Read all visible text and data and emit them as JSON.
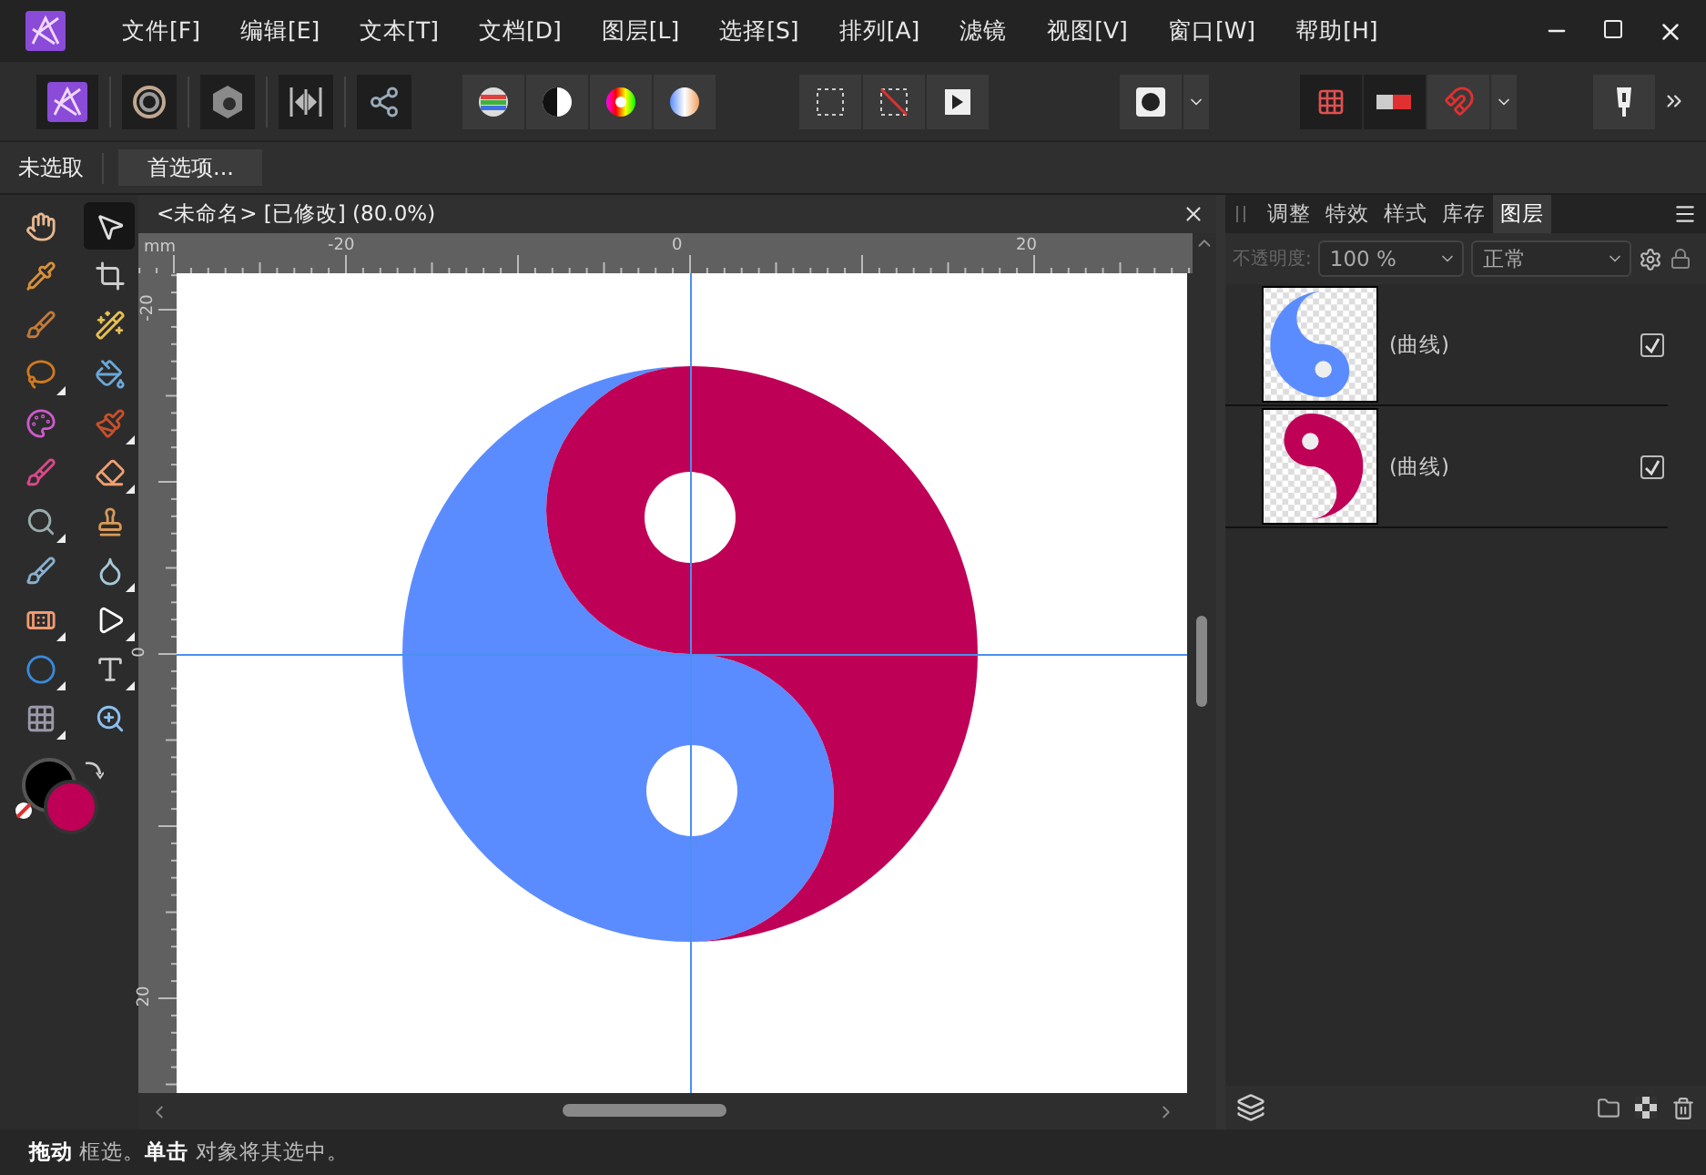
{
  "menu": [
    "文件[F]",
    "编辑[E]",
    "文本[T]",
    "文档[D]",
    "图层[L]",
    "选择[S]",
    "排列[A]",
    "滤镜",
    "视图[V]",
    "窗口[W]",
    "帮助[H]"
  ],
  "context_bar": {
    "status": "未选取",
    "button": "首选项..."
  },
  "tools": [
    {
      "selected": false,
      "flyout": false
    },
    {
      "selected": true,
      "flyout": false
    },
    {
      "selected": false,
      "flyout": false
    },
    {
      "selected": false,
      "flyout": false
    },
    {
      "selected": false,
      "flyout": false
    },
    {
      "selected": false,
      "flyout": false
    },
    {
      "selected": false,
      "flyout": true
    },
    {
      "selected": false,
      "flyout": false
    },
    {
      "selected": false,
      "flyout": false
    },
    {
      "selected": false,
      "flyout": true
    },
    {
      "selected": false,
      "flyout": false
    },
    {
      "selected": false,
      "flyout": true
    },
    {
      "selected": false,
      "flyout": true
    },
    {
      "selected": false,
      "flyout": false
    },
    {
      "selected": false,
      "flyout": false
    },
    {
      "selected": false,
      "flyout": true
    },
    {
      "selected": false,
      "flyout": true
    },
    {
      "selected": false,
      "flyout": true
    },
    {
      "selected": false,
      "flyout": true
    },
    {
      "selected": false,
      "flyout": true
    },
    {
      "selected": false,
      "flyout": true
    },
    {
      "selected": false,
      "flyout": false
    }
  ],
  "document": {
    "title": "<未命名> [已修改] (80.0%)",
    "ruler": {
      "unit": "mm",
      "horizontal": [
        "-20",
        "0",
        "20"
      ],
      "vertical": [
        "-20",
        "0",
        "20"
      ]
    }
  },
  "panel": {
    "tabs": [
      {
        "label": "调整",
        "selected": false
      },
      {
        "label": "特效",
        "selected": false
      },
      {
        "label": "样式",
        "selected": false
      },
      {
        "label": "库存",
        "selected": false
      },
      {
        "label": "图层",
        "selected": true
      }
    ],
    "opacity_label": "不透明度:",
    "opacity": "100 %",
    "blend_mode": "正常",
    "layers": [
      {
        "name": "(曲线)",
        "visible": true,
        "kind": "light"
      },
      {
        "name": "(曲线)",
        "visible": true,
        "kind": "dark"
      }
    ]
  },
  "status_bar": "**拖动** 框选。**单击** 对象将其选中。"
}
